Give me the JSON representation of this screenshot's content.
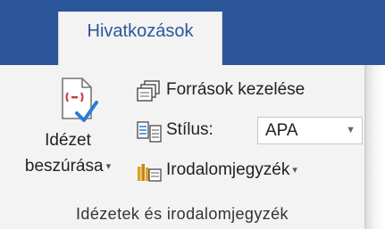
{
  "ribbon": {
    "tab": {
      "label": "Hivatkozások"
    },
    "insert_citation": {
      "line1": "Idézet",
      "line2": "beszúrása",
      "icon": "insert-citation-icon"
    },
    "manage_sources": {
      "label": "Források kezelése",
      "icon": "manage-sources-icon"
    },
    "style": {
      "label": "Stílus:",
      "value": "APA",
      "icon": "style-icon"
    },
    "bibliography": {
      "label": "Irodalomjegyzék",
      "icon": "bibliography-icon"
    },
    "group_label": "Idézetek és irodalomjegyzék"
  },
  "colors": {
    "accent": "#2b579a",
    "panel": "#f3f3f3",
    "citation_red": "#d13438"
  }
}
